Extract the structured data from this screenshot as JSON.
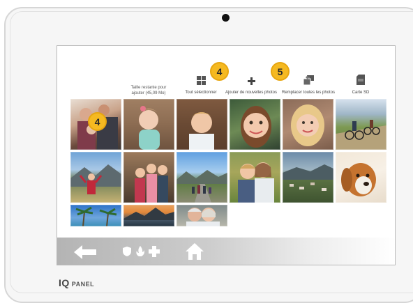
{
  "storage": {
    "line1": "Taille restante pour",
    "line2": "ajouter (45,09 Mo)"
  },
  "toolbar": {
    "select_all": "Tout sélectionner",
    "add_photos": "Ajouter de nouvelles photos",
    "replace_all": "Remplacer toutes les photos",
    "sd_card": "Carte SD"
  },
  "badges": {
    "select_all": "4",
    "add_photos": "5",
    "photo": "4"
  },
  "photos": [
    {
      "label": "family"
    },
    {
      "label": "toddler-girl"
    },
    {
      "label": "boy-smiling"
    },
    {
      "label": "girl-closeup"
    },
    {
      "label": "girl-blonde"
    },
    {
      "label": "cyclists"
    },
    {
      "label": "girl-mountains"
    },
    {
      "label": "kids-porch"
    },
    {
      "label": "family-road"
    },
    {
      "label": "siblings-flowers"
    },
    {
      "label": "hillside-town"
    },
    {
      "label": "puppy"
    },
    {
      "label": "palm-trees"
    },
    {
      "label": "mountain-lake"
    },
    {
      "label": "couple"
    }
  ],
  "bottom_nav": [
    "back-arrow-icon",
    "shield-icon",
    "fire-icon",
    "medical-plus-icon",
    "home-icon"
  ],
  "brand": {
    "q": "IQ",
    "panel": "PANEL"
  }
}
